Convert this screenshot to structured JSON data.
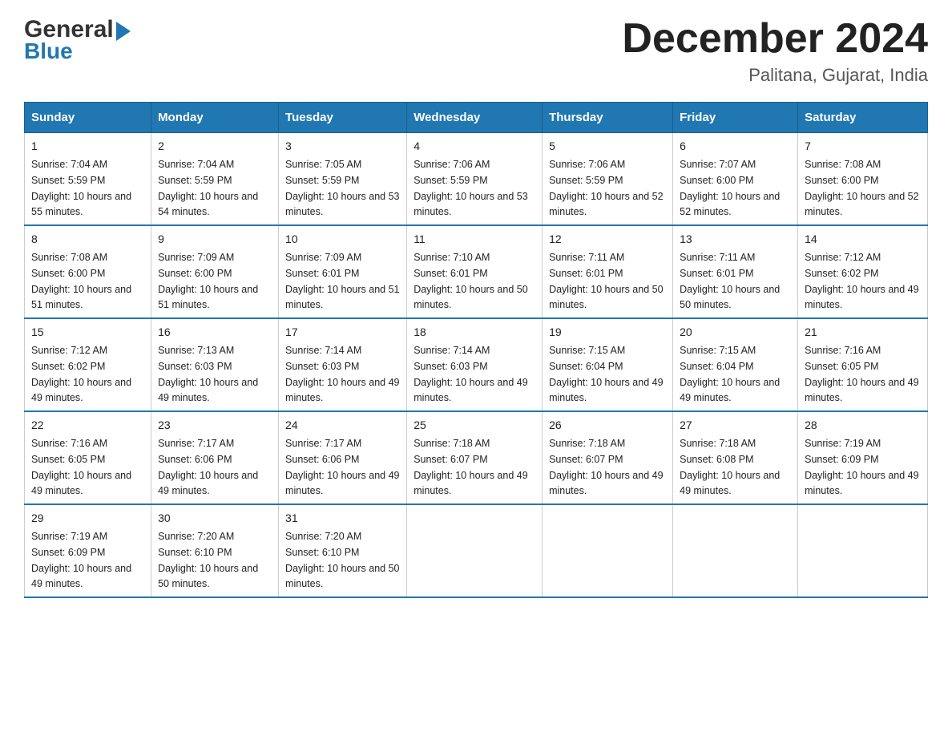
{
  "logo": {
    "general": "General",
    "blue": "Blue"
  },
  "header": {
    "month": "December 2024",
    "location": "Palitana, Gujarat, India"
  },
  "weekdays": [
    "Sunday",
    "Monday",
    "Tuesday",
    "Wednesday",
    "Thursday",
    "Friday",
    "Saturday"
  ],
  "weeks": [
    [
      {
        "day": "1",
        "sunrise": "7:04 AM",
        "sunset": "5:59 PM",
        "daylight": "10 hours and 55 minutes."
      },
      {
        "day": "2",
        "sunrise": "7:04 AM",
        "sunset": "5:59 PM",
        "daylight": "10 hours and 54 minutes."
      },
      {
        "day": "3",
        "sunrise": "7:05 AM",
        "sunset": "5:59 PM",
        "daylight": "10 hours and 53 minutes."
      },
      {
        "day": "4",
        "sunrise": "7:06 AM",
        "sunset": "5:59 PM",
        "daylight": "10 hours and 53 minutes."
      },
      {
        "day": "5",
        "sunrise": "7:06 AM",
        "sunset": "5:59 PM",
        "daylight": "10 hours and 52 minutes."
      },
      {
        "day": "6",
        "sunrise": "7:07 AM",
        "sunset": "6:00 PM",
        "daylight": "10 hours and 52 minutes."
      },
      {
        "day": "7",
        "sunrise": "7:08 AM",
        "sunset": "6:00 PM",
        "daylight": "10 hours and 52 minutes."
      }
    ],
    [
      {
        "day": "8",
        "sunrise": "7:08 AM",
        "sunset": "6:00 PM",
        "daylight": "10 hours and 51 minutes."
      },
      {
        "day": "9",
        "sunrise": "7:09 AM",
        "sunset": "6:00 PM",
        "daylight": "10 hours and 51 minutes."
      },
      {
        "day": "10",
        "sunrise": "7:09 AM",
        "sunset": "6:01 PM",
        "daylight": "10 hours and 51 minutes."
      },
      {
        "day": "11",
        "sunrise": "7:10 AM",
        "sunset": "6:01 PM",
        "daylight": "10 hours and 50 minutes."
      },
      {
        "day": "12",
        "sunrise": "7:11 AM",
        "sunset": "6:01 PM",
        "daylight": "10 hours and 50 minutes."
      },
      {
        "day": "13",
        "sunrise": "7:11 AM",
        "sunset": "6:01 PM",
        "daylight": "10 hours and 50 minutes."
      },
      {
        "day": "14",
        "sunrise": "7:12 AM",
        "sunset": "6:02 PM",
        "daylight": "10 hours and 49 minutes."
      }
    ],
    [
      {
        "day": "15",
        "sunrise": "7:12 AM",
        "sunset": "6:02 PM",
        "daylight": "10 hours and 49 minutes."
      },
      {
        "day": "16",
        "sunrise": "7:13 AM",
        "sunset": "6:03 PM",
        "daylight": "10 hours and 49 minutes."
      },
      {
        "day": "17",
        "sunrise": "7:14 AM",
        "sunset": "6:03 PM",
        "daylight": "10 hours and 49 minutes."
      },
      {
        "day": "18",
        "sunrise": "7:14 AM",
        "sunset": "6:03 PM",
        "daylight": "10 hours and 49 minutes."
      },
      {
        "day": "19",
        "sunrise": "7:15 AM",
        "sunset": "6:04 PM",
        "daylight": "10 hours and 49 minutes."
      },
      {
        "day": "20",
        "sunrise": "7:15 AM",
        "sunset": "6:04 PM",
        "daylight": "10 hours and 49 minutes."
      },
      {
        "day": "21",
        "sunrise": "7:16 AM",
        "sunset": "6:05 PM",
        "daylight": "10 hours and 49 minutes."
      }
    ],
    [
      {
        "day": "22",
        "sunrise": "7:16 AM",
        "sunset": "6:05 PM",
        "daylight": "10 hours and 49 minutes."
      },
      {
        "day": "23",
        "sunrise": "7:17 AM",
        "sunset": "6:06 PM",
        "daylight": "10 hours and 49 minutes."
      },
      {
        "day": "24",
        "sunrise": "7:17 AM",
        "sunset": "6:06 PM",
        "daylight": "10 hours and 49 minutes."
      },
      {
        "day": "25",
        "sunrise": "7:18 AM",
        "sunset": "6:07 PM",
        "daylight": "10 hours and 49 minutes."
      },
      {
        "day": "26",
        "sunrise": "7:18 AM",
        "sunset": "6:07 PM",
        "daylight": "10 hours and 49 minutes."
      },
      {
        "day": "27",
        "sunrise": "7:18 AM",
        "sunset": "6:08 PM",
        "daylight": "10 hours and 49 minutes."
      },
      {
        "day": "28",
        "sunrise": "7:19 AM",
        "sunset": "6:09 PM",
        "daylight": "10 hours and 49 minutes."
      }
    ],
    [
      {
        "day": "29",
        "sunrise": "7:19 AM",
        "sunset": "6:09 PM",
        "daylight": "10 hours and 49 minutes."
      },
      {
        "day": "30",
        "sunrise": "7:20 AM",
        "sunset": "6:10 PM",
        "daylight": "10 hours and 50 minutes."
      },
      {
        "day": "31",
        "sunrise": "7:20 AM",
        "sunset": "6:10 PM",
        "daylight": "10 hours and 50 minutes."
      },
      null,
      null,
      null,
      null
    ]
  ]
}
